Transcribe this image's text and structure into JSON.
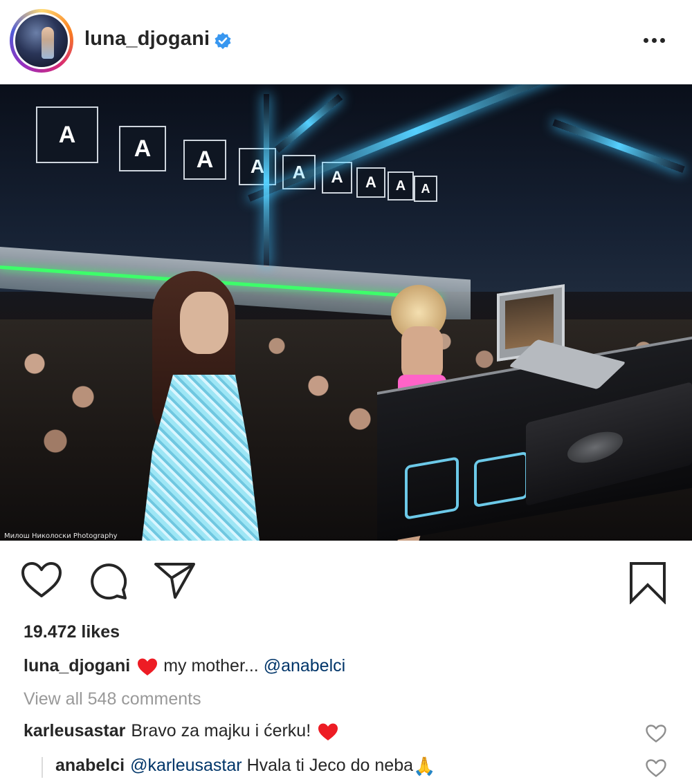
{
  "post": {
    "username": "luna_djogani",
    "verified_icon": "verified-badge-icon",
    "more_icon": "more-options-icon"
  },
  "photo": {
    "banner_letter": "A",
    "credit": "Милош Николоски Photography"
  },
  "actions": {
    "like_icon": "heart-outline-icon",
    "comment_icon": "comment-bubble-icon",
    "share_icon": "paper-plane-icon",
    "save_icon": "bookmark-icon"
  },
  "likes": "19.472 likes",
  "caption": {
    "username": "luna_djogani",
    "text": "my mother...",
    "mention": "@anabelci"
  },
  "view_all_comments": "View all 548 comments",
  "comments": [
    {
      "username": "karleusastar",
      "text": "Bravo za majku i ćerku!",
      "emoji": "red-heart"
    },
    {
      "username": "anabelci",
      "mention": "@karleusastar",
      "text": "Hvala ti Jeco do neba",
      "emoji": "🙏"
    }
  ],
  "colors": {
    "text": "#262626",
    "muted": "#999999",
    "mention": "#003569",
    "verified": "#3897f0",
    "heart": "#ed1c24"
  }
}
